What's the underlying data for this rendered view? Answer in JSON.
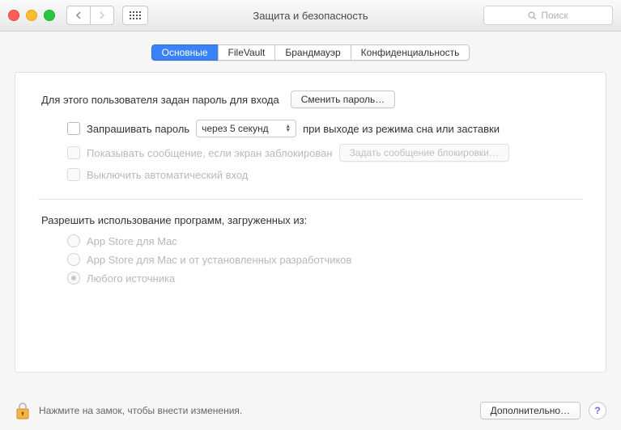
{
  "window": {
    "title": "Защита и безопасность",
    "search_placeholder": "Поиск"
  },
  "tabs": [
    "Основные",
    "FileVault",
    "Брандмауэр",
    "Конфиденциальность"
  ],
  "general": {
    "password_set_label": "Для этого пользователя задан пароль для входа",
    "change_password_btn": "Сменить пароль…",
    "require_password_label": "Запрашивать пароль",
    "require_password_delay": "через 5 секунд",
    "require_password_suffix": "при выходе из режима сна или заставки",
    "show_message_label": "Показывать сообщение, если экран заблокирован",
    "set_lock_message_btn": "Задать сообщение блокировки…",
    "disable_autologin_label": "Выключить автоматический вход",
    "allow_apps_label": "Разрешить использование программ, загруженных из:",
    "allow_apps_options": [
      "App Store для Mac",
      "App Store для Mac и от установленных разработчиков",
      "Любого источника"
    ],
    "allow_apps_selected_index": 2
  },
  "footer": {
    "lock_hint": "Нажмите на замок, чтобы внести изменения.",
    "advanced_btn": "Дополнительно…"
  }
}
